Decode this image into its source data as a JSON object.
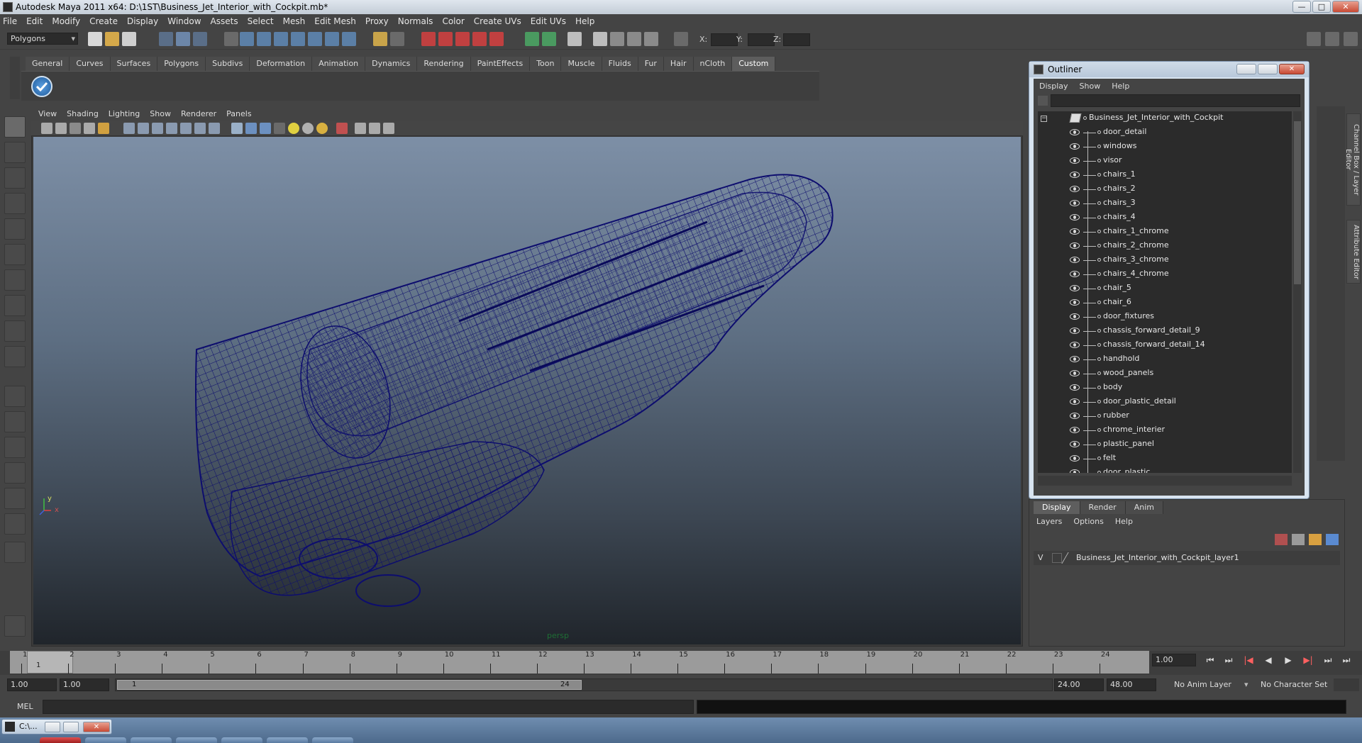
{
  "window": {
    "title": "Autodesk Maya 2011 x64: D:\\1ST\\Business_Jet_Interior_with_Cockpit.mb*",
    "min": "—",
    "max": "□",
    "close": "✕"
  },
  "menubar": [
    "File",
    "Edit",
    "Modify",
    "Create",
    "Display",
    "Window",
    "Assets",
    "Select",
    "Mesh",
    "Edit Mesh",
    "Proxy",
    "Normals",
    "Color",
    "Create UVs",
    "Edit UVs",
    "Help"
  ],
  "statusline": {
    "mode": "Polygons",
    "x_label": "X:",
    "y_label": "Y:",
    "z_label": "Z:"
  },
  "shelf": {
    "tabs": [
      "General",
      "Curves",
      "Surfaces",
      "Polygons",
      "Subdivs",
      "Deformation",
      "Animation",
      "Dynamics",
      "Rendering",
      "PaintEffects",
      "Toon",
      "Muscle",
      "Fluids",
      "Fur",
      "Hair",
      "nCloth",
      "Custom"
    ],
    "active_tab": "Custom"
  },
  "viewport": {
    "menu": [
      "View",
      "Shading",
      "Lighting",
      "Show",
      "Renderer",
      "Panels"
    ],
    "camera_label": "persp",
    "axis_y": "y",
    "axis_x": "x",
    "wireframe_color": "#0d0d6e"
  },
  "outliner": {
    "title": "Outliner",
    "menu": [
      "Display",
      "Show",
      "Help"
    ],
    "root": "Business_Jet_Interior_with_Cockpit",
    "items": [
      "door_detail",
      "windows",
      "visor",
      "chairs_1",
      "chairs_2",
      "chairs_3",
      "chairs_4",
      "chairs_1_chrome",
      "chairs_2_chrome",
      "chairs_3_chrome",
      "chairs_4_chrome",
      "chair_5",
      "chair_6",
      "door_fixtures",
      "chassis_forward_detail_9",
      "chassis_forward_detail_14",
      "handhold",
      "wood_panels",
      "body",
      "door_plastic_detail",
      "rubber",
      "chrome_interier",
      "plastic_panel",
      "felt",
      "door_plastic"
    ]
  },
  "right_strip": {
    "tab1": "Channel Box / Layer Editor",
    "tab2": "Attribute Editor"
  },
  "layers": {
    "tabs": [
      "Display",
      "Render",
      "Anim"
    ],
    "active_tab": "Display",
    "menu": [
      "Layers",
      "Options",
      "Help"
    ],
    "layer_visibility": "V",
    "layer_name": "Business_Jet_Interior_with_Cockpit_layer1"
  },
  "timeline": {
    "ticks": [
      "1",
      "2",
      "3",
      "4",
      "5",
      "6",
      "7",
      "8",
      "9",
      "10",
      "11",
      "12",
      "13",
      "14",
      "15",
      "16",
      "17",
      "18",
      "19",
      "20",
      "21",
      "22",
      "23",
      "24"
    ],
    "current_frame_marker": "1",
    "current_frame_field": "1.00"
  },
  "range": {
    "start_time": "1.00",
    "playback_start": "1.00",
    "handle_start": "1",
    "handle_end": "24",
    "playback_end": "24.00",
    "end_time": "48.00",
    "anim_layer": "No Anim Layer",
    "character_set": "No Character Set"
  },
  "command": {
    "label": "MEL"
  },
  "taskbar": {
    "mini_title": "C:\\..."
  }
}
